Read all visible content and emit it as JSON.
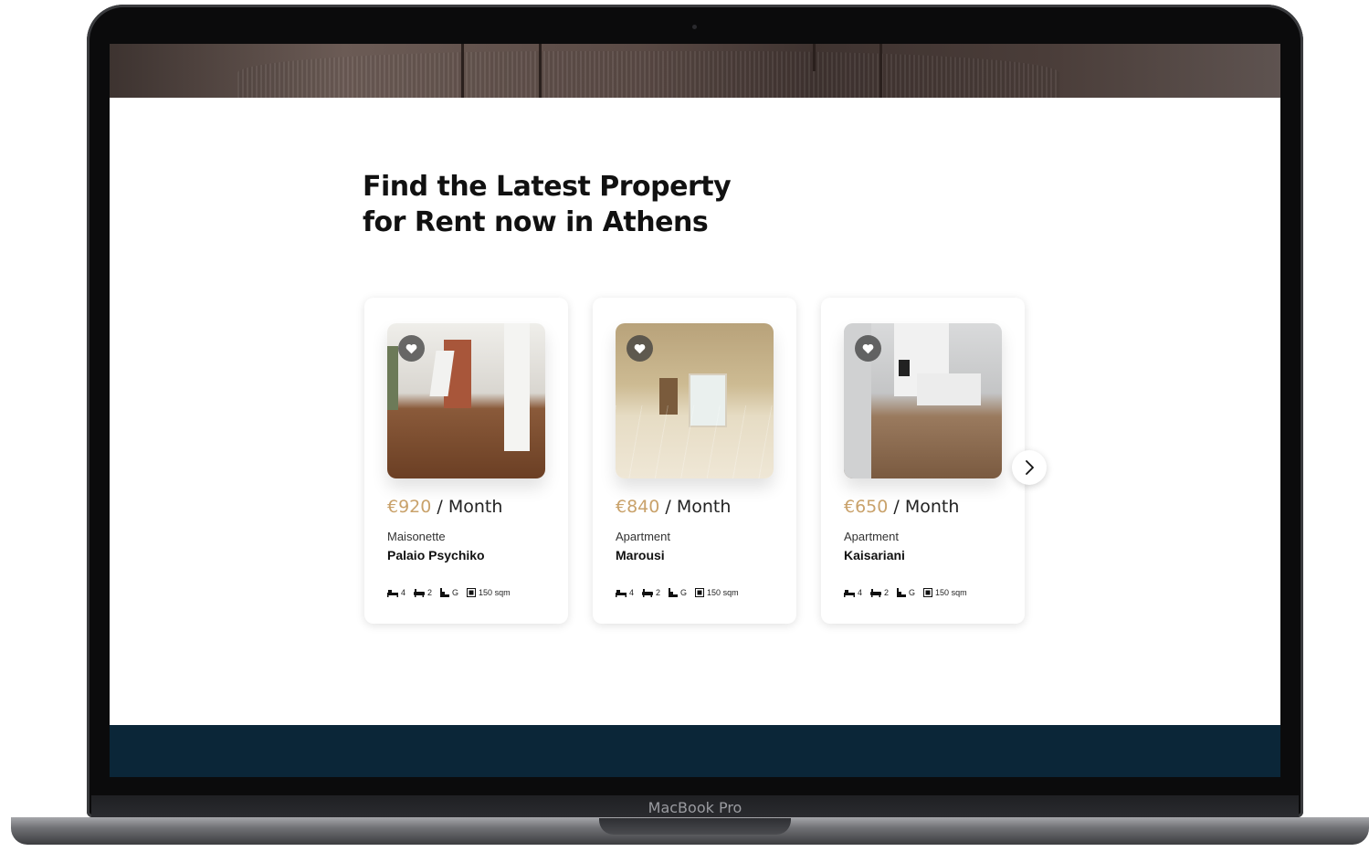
{
  "section": {
    "title_line1": "Find the Latest Property",
    "title_line2": "for Rent now in Athens"
  },
  "listings": [
    {
      "price": "€920",
      "period": " / Month",
      "type": "Maisonette",
      "location": "Palaio Psychiko",
      "beds": "4",
      "baths": "2",
      "floor": "G",
      "area": "150 sqm"
    },
    {
      "price": "€840",
      "period": " / Month",
      "type": "Apartment",
      "location": "Marousi",
      "beds": "4",
      "baths": "2",
      "floor": "G",
      "area": "150 sqm"
    },
    {
      "price": "€650",
      "period": " / Month",
      "type": "Apartment",
      "location": "Kaisariani",
      "beds": "4",
      "baths": "2",
      "floor": "G",
      "area": "150 sqm"
    }
  ],
  "device": {
    "model": "MacBook Pro"
  },
  "colors": {
    "accent": "#c9a26b",
    "footer": "#0b2638",
    "text": "#111111"
  },
  "icons": {
    "favorite": "heart-icon",
    "next": "chevron-right-icon",
    "beds": "bed-icon",
    "baths": "bathtub-icon",
    "floor": "stairs-icon",
    "area": "area-icon"
  }
}
